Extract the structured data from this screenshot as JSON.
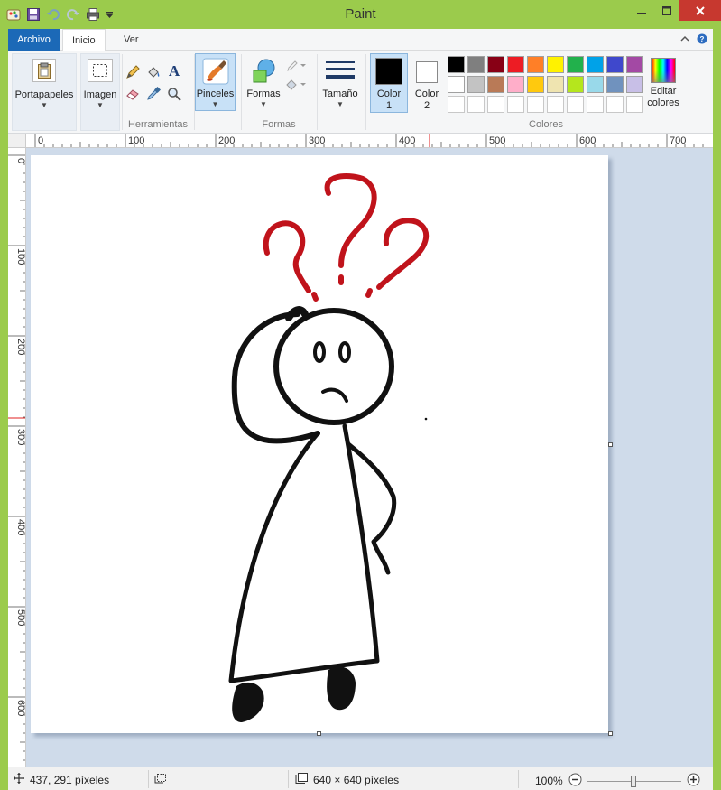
{
  "window": {
    "title": "Paint"
  },
  "quick_access": [
    "paint-app-icon",
    "save-icon",
    "undo-icon",
    "redo-icon",
    "print-icon",
    "customize-dropdown-icon"
  ],
  "tabs": [
    {
      "label": "Archivo"
    },
    {
      "label": "Inicio"
    },
    {
      "label": "Ver"
    }
  ],
  "ribbon": {
    "clipboard": {
      "label": "Portapapeles"
    },
    "image": {
      "label": "Imagen"
    },
    "tools": {
      "group_label": "Herramientas"
    },
    "brushes": {
      "label": "Pinceles"
    },
    "shapes": {
      "label": "Formas",
      "group_label": "Formas"
    },
    "size": {
      "label": "Tamaño"
    },
    "color1": {
      "label": "Color",
      "num": "1",
      "value": "#000000"
    },
    "color2": {
      "label": "Color",
      "num": "2",
      "value": "#ffffff"
    },
    "colors": {
      "group_label": "Colores",
      "row1": [
        "#000000",
        "#7f7f7f",
        "#880015",
        "#ed1c24",
        "#ff7f27",
        "#fff200",
        "#22b14c",
        "#00a2e8",
        "#3f48cc",
        "#a349a4"
      ],
      "row2": [
        "#ffffff",
        "#c3c3c3",
        "#b97a57",
        "#ffaec9",
        "#ffc90e",
        "#efe4b0",
        "#b5e61d",
        "#99d9ea",
        "#7092be",
        "#c8bfe7"
      ]
    },
    "edit_colors": {
      "line1": "Editar",
      "line2": "colores"
    }
  },
  "ruler": {
    "h_labels": [
      "0",
      "100",
      "200",
      "300",
      "400",
      "500",
      "600",
      "700"
    ],
    "v_labels": [
      "0",
      "100",
      "200",
      "300",
      "400",
      "500",
      "600"
    ]
  },
  "status": {
    "cursor": "437, 291 píxeles",
    "size": "640 × 640 píxeles",
    "zoom": "100%",
    "zoom_fraction": 0.5
  },
  "accent": {
    "file_tab": "#1c69b7",
    "window_frame": "#9bcb4c",
    "close": "#c7382f",
    "doodle_red": "#c0131b"
  }
}
